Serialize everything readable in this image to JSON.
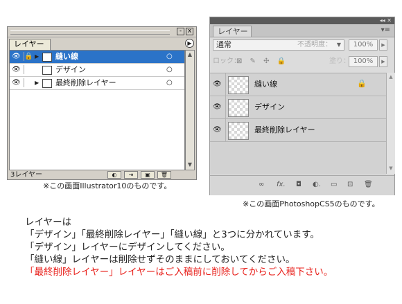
{
  "illustrator": {
    "tab": "レイヤー",
    "window_buttons": [
      "-",
      "x"
    ],
    "menu_icon": "triangle-right-circle-icon",
    "layers": [
      {
        "name": "縫い線",
        "selected": true,
        "eye": "👁",
        "lock": "🔒",
        "has_arrow": true,
        "circle": "○"
      },
      {
        "name": "デザイン",
        "selected": false,
        "eye": "👁",
        "lock": "",
        "has_arrow": false,
        "circle": "○"
      },
      {
        "name": "最終削除レイヤー",
        "selected": false,
        "eye": "👁",
        "lock": "",
        "has_arrow": true,
        "circle": "○"
      }
    ],
    "footer_count": "3レイヤー",
    "footer_buttons": [
      "make-clipping-mask",
      "new-sublayer",
      "new-layer",
      "delete-layer"
    ],
    "scroll_up": "▲",
    "scroll_down": "▼",
    "caption": "※この画面Illustrator10のものです。",
    "colors": {
      "selected_row": "#2b73c8"
    }
  },
  "photoshop": {
    "top_controls": "◂◂ ✕",
    "tab": "レイヤー",
    "menu_icon": "▾≡",
    "blend_mode": "通常",
    "opacity_label": "不透明度：",
    "opacity_value": "100%",
    "lock_label": "ロック：",
    "lock_icons": "⊠ ✎ ✣ 🔒",
    "fill_label": "塗り：",
    "fill_value": "100%",
    "layers": [
      {
        "name": "縫い線",
        "locked": true,
        "eye": "👁",
        "lock_icon": "🔒"
      },
      {
        "name": "デザイン",
        "locked": false,
        "eye": "👁",
        "lock_icon": ""
      },
      {
        "name": "最終削除レイヤー",
        "locked": false,
        "eye": "👁",
        "lock_icon": ""
      }
    ],
    "footer_icons": [
      "∞",
      "fx.",
      "◘",
      "◐.",
      "▭",
      "⊡",
      "🗑"
    ],
    "caption": "※この画面PhotoshopCS5のものです。"
  },
  "instructions": {
    "lines": [
      "レイヤーは",
      "「デザイン」「最終削除レイヤー」「縫い線」と3つに分かれています。",
      "「デザイン」レイヤーにデザインしてください。",
      "「縫い線」レイヤーは削除せずそのままにしておいてください。",
      "「最終削除レイヤー」レイヤーはご入稿前に削除してからご入稿下さい。"
    ],
    "warning_color": "#e8211c"
  }
}
